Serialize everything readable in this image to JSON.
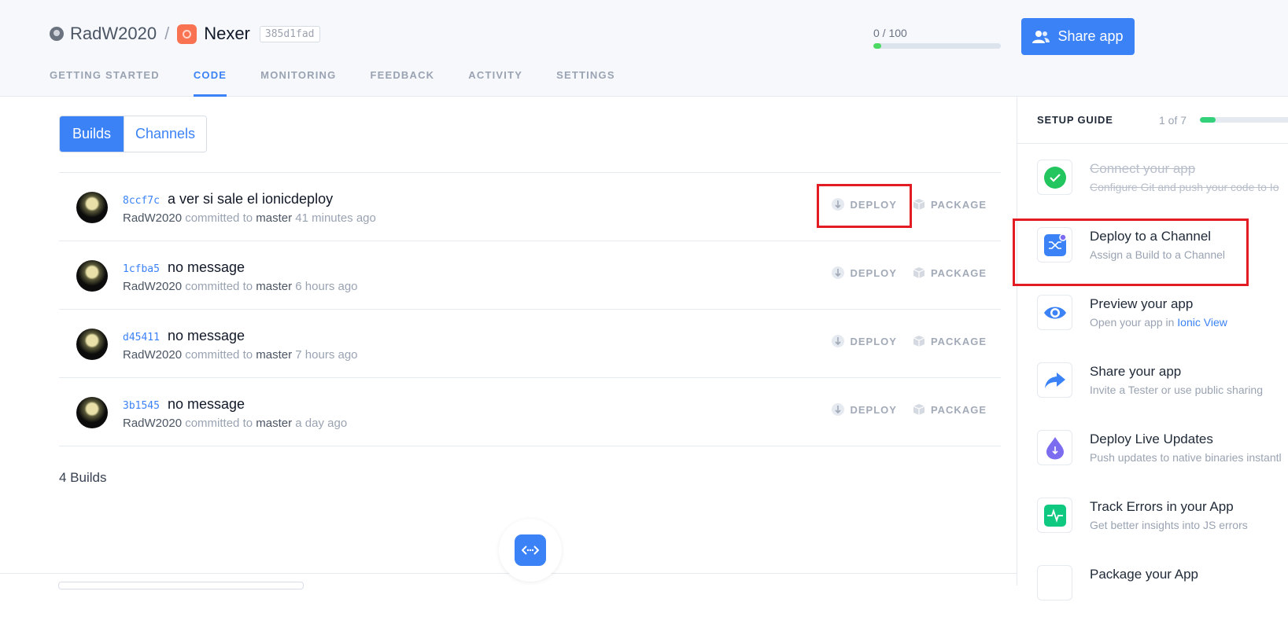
{
  "header": {
    "org_name": "RadW2020",
    "separator": "/",
    "app_name": "Nexer",
    "app_hash": "385d1fad",
    "usage": {
      "text": "0 / 100",
      "used": 0,
      "max": 100
    },
    "share_button": "Share app"
  },
  "tabs": [
    {
      "label": "GETTING STARTED",
      "active": false
    },
    {
      "label": "CODE",
      "active": true
    },
    {
      "label": "MONITORING",
      "active": false
    },
    {
      "label": "FEEDBACK",
      "active": false
    },
    {
      "label": "ACTIVITY",
      "active": false
    },
    {
      "label": "SETTINGS",
      "active": false
    }
  ],
  "segments": {
    "builds": "Builds",
    "channels": "Channels",
    "active": "Builds"
  },
  "builds": [
    {
      "hash": "8ccf7c",
      "message": "a ver si sale el ionicdeploy",
      "author": "RadW2020",
      "committed_to": "committed to",
      "branch": "master",
      "time": "41 minutes ago",
      "deploy": "DEPLOY",
      "package": "PACKAGE"
    },
    {
      "hash": "1cfba5",
      "message": "no message",
      "author": "RadW2020",
      "committed_to": "committed to",
      "branch": "master",
      "time": "6 hours ago",
      "deploy": "DEPLOY",
      "package": "PACKAGE"
    },
    {
      "hash": "d45411",
      "message": "no message",
      "author": "RadW2020",
      "committed_to": "committed to",
      "branch": "master",
      "time": "7 hours ago",
      "deploy": "DEPLOY",
      "package": "PACKAGE"
    },
    {
      "hash": "3b1545",
      "message": "no message",
      "author": "RadW2020",
      "committed_to": "committed to",
      "branch": "master",
      "time": "a day ago",
      "deploy": "DEPLOY",
      "package": "PACKAGE"
    }
  ],
  "builds_count": "4 Builds",
  "setup_guide": {
    "title": "SETUP GUIDE",
    "progress_text": "1 of 7",
    "progress_done": 1,
    "progress_total": 7,
    "items": [
      {
        "title": "Connect your app",
        "desc": "Configure Git and push your code to Io",
        "done": true,
        "icon": "check-circle-icon",
        "color": "#22c55e"
      },
      {
        "title": "Deploy to a Channel",
        "desc": "Assign a Build to a Channel",
        "done": false,
        "icon": "shuffle-icon",
        "color": "#3b82f6"
      },
      {
        "title": "Preview your app",
        "desc_prefix": "Open your app in ",
        "desc_link": "Ionic View",
        "done": false,
        "icon": "eye-icon",
        "color": "#3b82f6"
      },
      {
        "title": "Share your app",
        "desc": "Invite a Tester or use public sharing",
        "done": false,
        "icon": "share-arrow-icon",
        "color": "#3b82f6"
      },
      {
        "title": "Deploy Live Updates",
        "desc": "Push updates to native binaries instantl",
        "done": false,
        "icon": "drop-icon",
        "color": "#7c6cf0"
      },
      {
        "title": "Track Errors in your App",
        "desc": "Get better insights into JS errors",
        "done": false,
        "icon": "pulse-icon",
        "color": "#10c981"
      },
      {
        "title": "Package your App",
        "desc": "",
        "done": false,
        "icon": "package-icon",
        "color": "#3b82f6"
      }
    ]
  },
  "colors": {
    "accent": "#3b82f6",
    "highlight": "#e31b23",
    "success": "#4cd964"
  }
}
